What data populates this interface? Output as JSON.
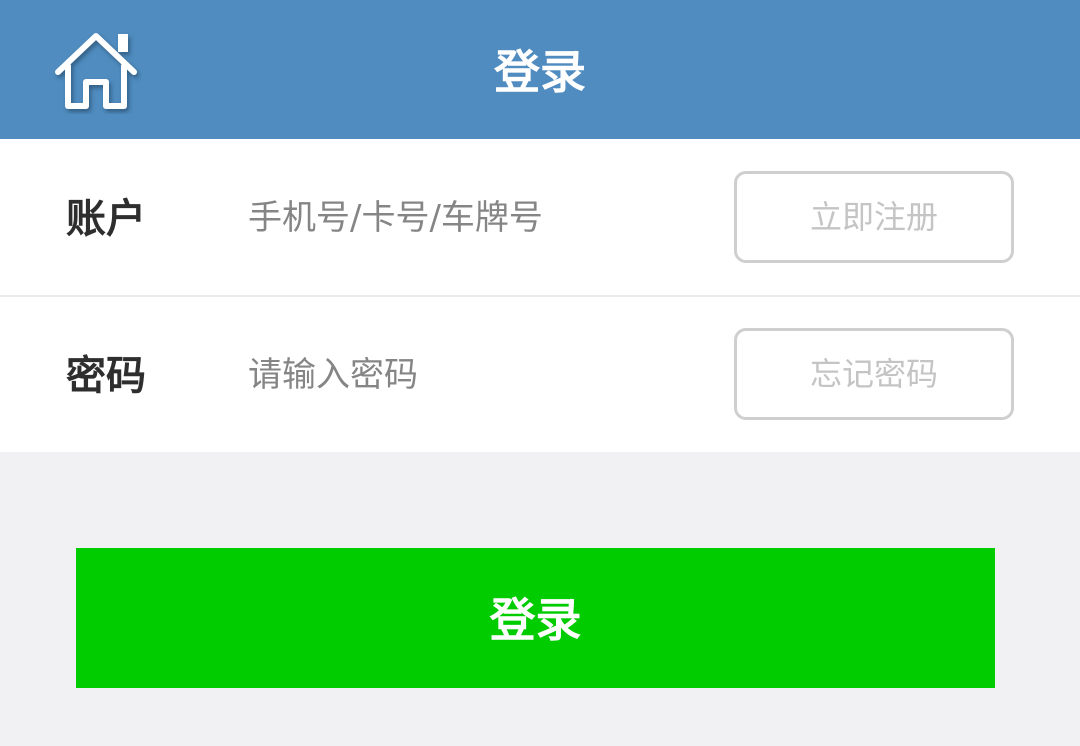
{
  "header": {
    "title": "登录",
    "home_icon": "home-icon"
  },
  "form": {
    "account": {
      "label": "账户",
      "placeholder": "手机号/卡号/车牌号",
      "value": "",
      "side_button": "立即注册"
    },
    "password": {
      "label": "密码",
      "placeholder": "请输入密码",
      "value": "",
      "side_button": "忘记密码"
    }
  },
  "login_button": "登录",
  "colors": {
    "header_bg": "#508cbf",
    "login_bg": "#00cc00",
    "page_bg": "#f1f0f2"
  }
}
